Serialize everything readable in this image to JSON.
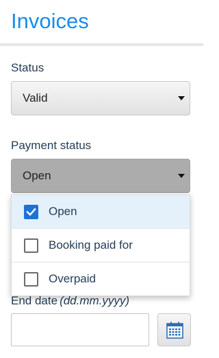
{
  "page": {
    "title": "Invoices"
  },
  "status_field": {
    "label": "Status",
    "selected": "Valid"
  },
  "payment_status_field": {
    "label": "Payment status",
    "selected": "Open",
    "options": [
      {
        "label": "Open",
        "checked": true
      },
      {
        "label": "Booking paid for",
        "checked": false
      },
      {
        "label": "Overpaid",
        "checked": false
      }
    ]
  },
  "end_date_field": {
    "label": "End date",
    "format_hint": "(dd.mm.yyyy)",
    "value": "",
    "button_icon": "calendar-icon"
  },
  "colors": {
    "title": "#1a8ce8",
    "label": "#243d57",
    "checkbox_checked": "#1f72d6",
    "calendar_icon": "#2a6fb6"
  }
}
